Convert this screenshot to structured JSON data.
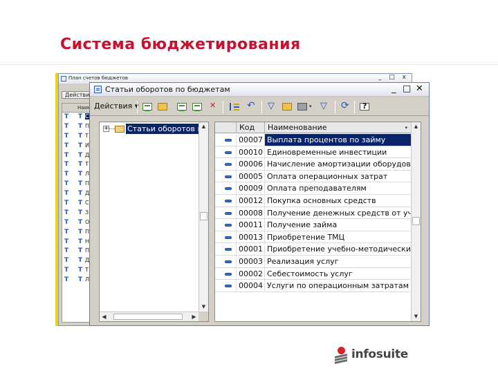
{
  "slide": {
    "title": "Система бюджетирования",
    "title_color": "#c8102e"
  },
  "back_window": {
    "title": "План счетов бюджетов",
    "action_menu": "Действия",
    "column_header": "Наим",
    "controls": "_ □ x",
    "rows": [
      {
        "t1": "Т",
        "t2": "Т",
        "text": "С",
        "selected": true
      },
      {
        "t1": "Т",
        "t2": "Т",
        "text": "П"
      },
      {
        "t1": "Т",
        "t2": "Т",
        "text": "Т"
      },
      {
        "t1": "Т",
        "t2": "Т",
        "text": "И"
      },
      {
        "t1": "Т",
        "t2": "Т",
        "text": "Д"
      },
      {
        "t1": "Т",
        "t2": "Т",
        "text": "Т"
      },
      {
        "t1": "Т",
        "t2": "Т",
        "text": "Л"
      },
      {
        "t1": "Т",
        "t2": "Т",
        "text": "П"
      },
      {
        "t1": "Т",
        "t2": "Т",
        "text": "Д"
      },
      {
        "t1": "Т",
        "t2": "Т",
        "text": "С"
      },
      {
        "t1": "Т",
        "t2": "Т",
        "text": "З"
      },
      {
        "t1": "Т",
        "t2": "Т",
        "text": "О"
      },
      {
        "t1": "Т",
        "t2": "Т",
        "text": "П"
      },
      {
        "t1": "Т",
        "t2": "Т",
        "text": "Н"
      },
      {
        "t1": "Т",
        "t2": "Т",
        "text": "П"
      },
      {
        "t1": "Т",
        "t2": "Т",
        "text": "Д"
      },
      {
        "t1": "Т",
        "t2": "Т",
        "text": "Т"
      },
      {
        "t1": "Т",
        "t2": "Т",
        "text": "Л"
      }
    ]
  },
  "front_window": {
    "title": "Статьи оборотов по бюджетам",
    "minimize": "_",
    "maximize": "□",
    "close": "✕",
    "toolbar": {
      "actions_label": "Действия",
      "actions_arrow": "▾",
      "icons": [
        "add-item-icon",
        "add-folder-icon",
        "copy-icon",
        "edit-icon",
        "mark-delete-icon",
        "set-order-icon",
        "back-icon",
        "filter-icon",
        "filter-by-folder-icon",
        "filter-dropdown-icon",
        "clear-filter-icon",
        "refresh-icon",
        "help-icon"
      ]
    },
    "tree": {
      "expand": "+",
      "root_label": "Статьи оборотов по бюджетам"
    },
    "table": {
      "columns": {
        "code": "Код",
        "name": "Наименование"
      },
      "sort_arrow": "▾",
      "rows": [
        {
          "code": "00007",
          "name": "Выплата процентов по займу",
          "selected": true
        },
        {
          "code": "00010",
          "name": "Единовременные инвестиции"
        },
        {
          "code": "00006",
          "name": "Начисление амортизации оборудова..."
        },
        {
          "code": "00005",
          "name": "Оплата операционных затрат"
        },
        {
          "code": "00009",
          "name": "Оплата преподавателям"
        },
        {
          "code": "00012",
          "name": "Покупка основных средств"
        },
        {
          "code": "00008",
          "name": "Получение денежных средств от уча..."
        },
        {
          "code": "00011",
          "name": "Получение займа"
        },
        {
          "code": "00013",
          "name": "Приобретение ТМЦ"
        },
        {
          "code": "00001",
          "name": "Приобретение учебно-методических ..."
        },
        {
          "code": "00003",
          "name": "Реализация услуг"
        },
        {
          "code": "00002",
          "name": "Себестоимость услуг"
        },
        {
          "code": "00004",
          "name": "Услуги по операционным затратам"
        }
      ]
    }
  },
  "logo": {
    "text": "infosuite",
    "mark_color": "#d7242c"
  },
  "colors": {
    "selection": "#0a246a",
    "window_bg": "#d4d0c8",
    "accent_stripe": "#f0d400"
  }
}
